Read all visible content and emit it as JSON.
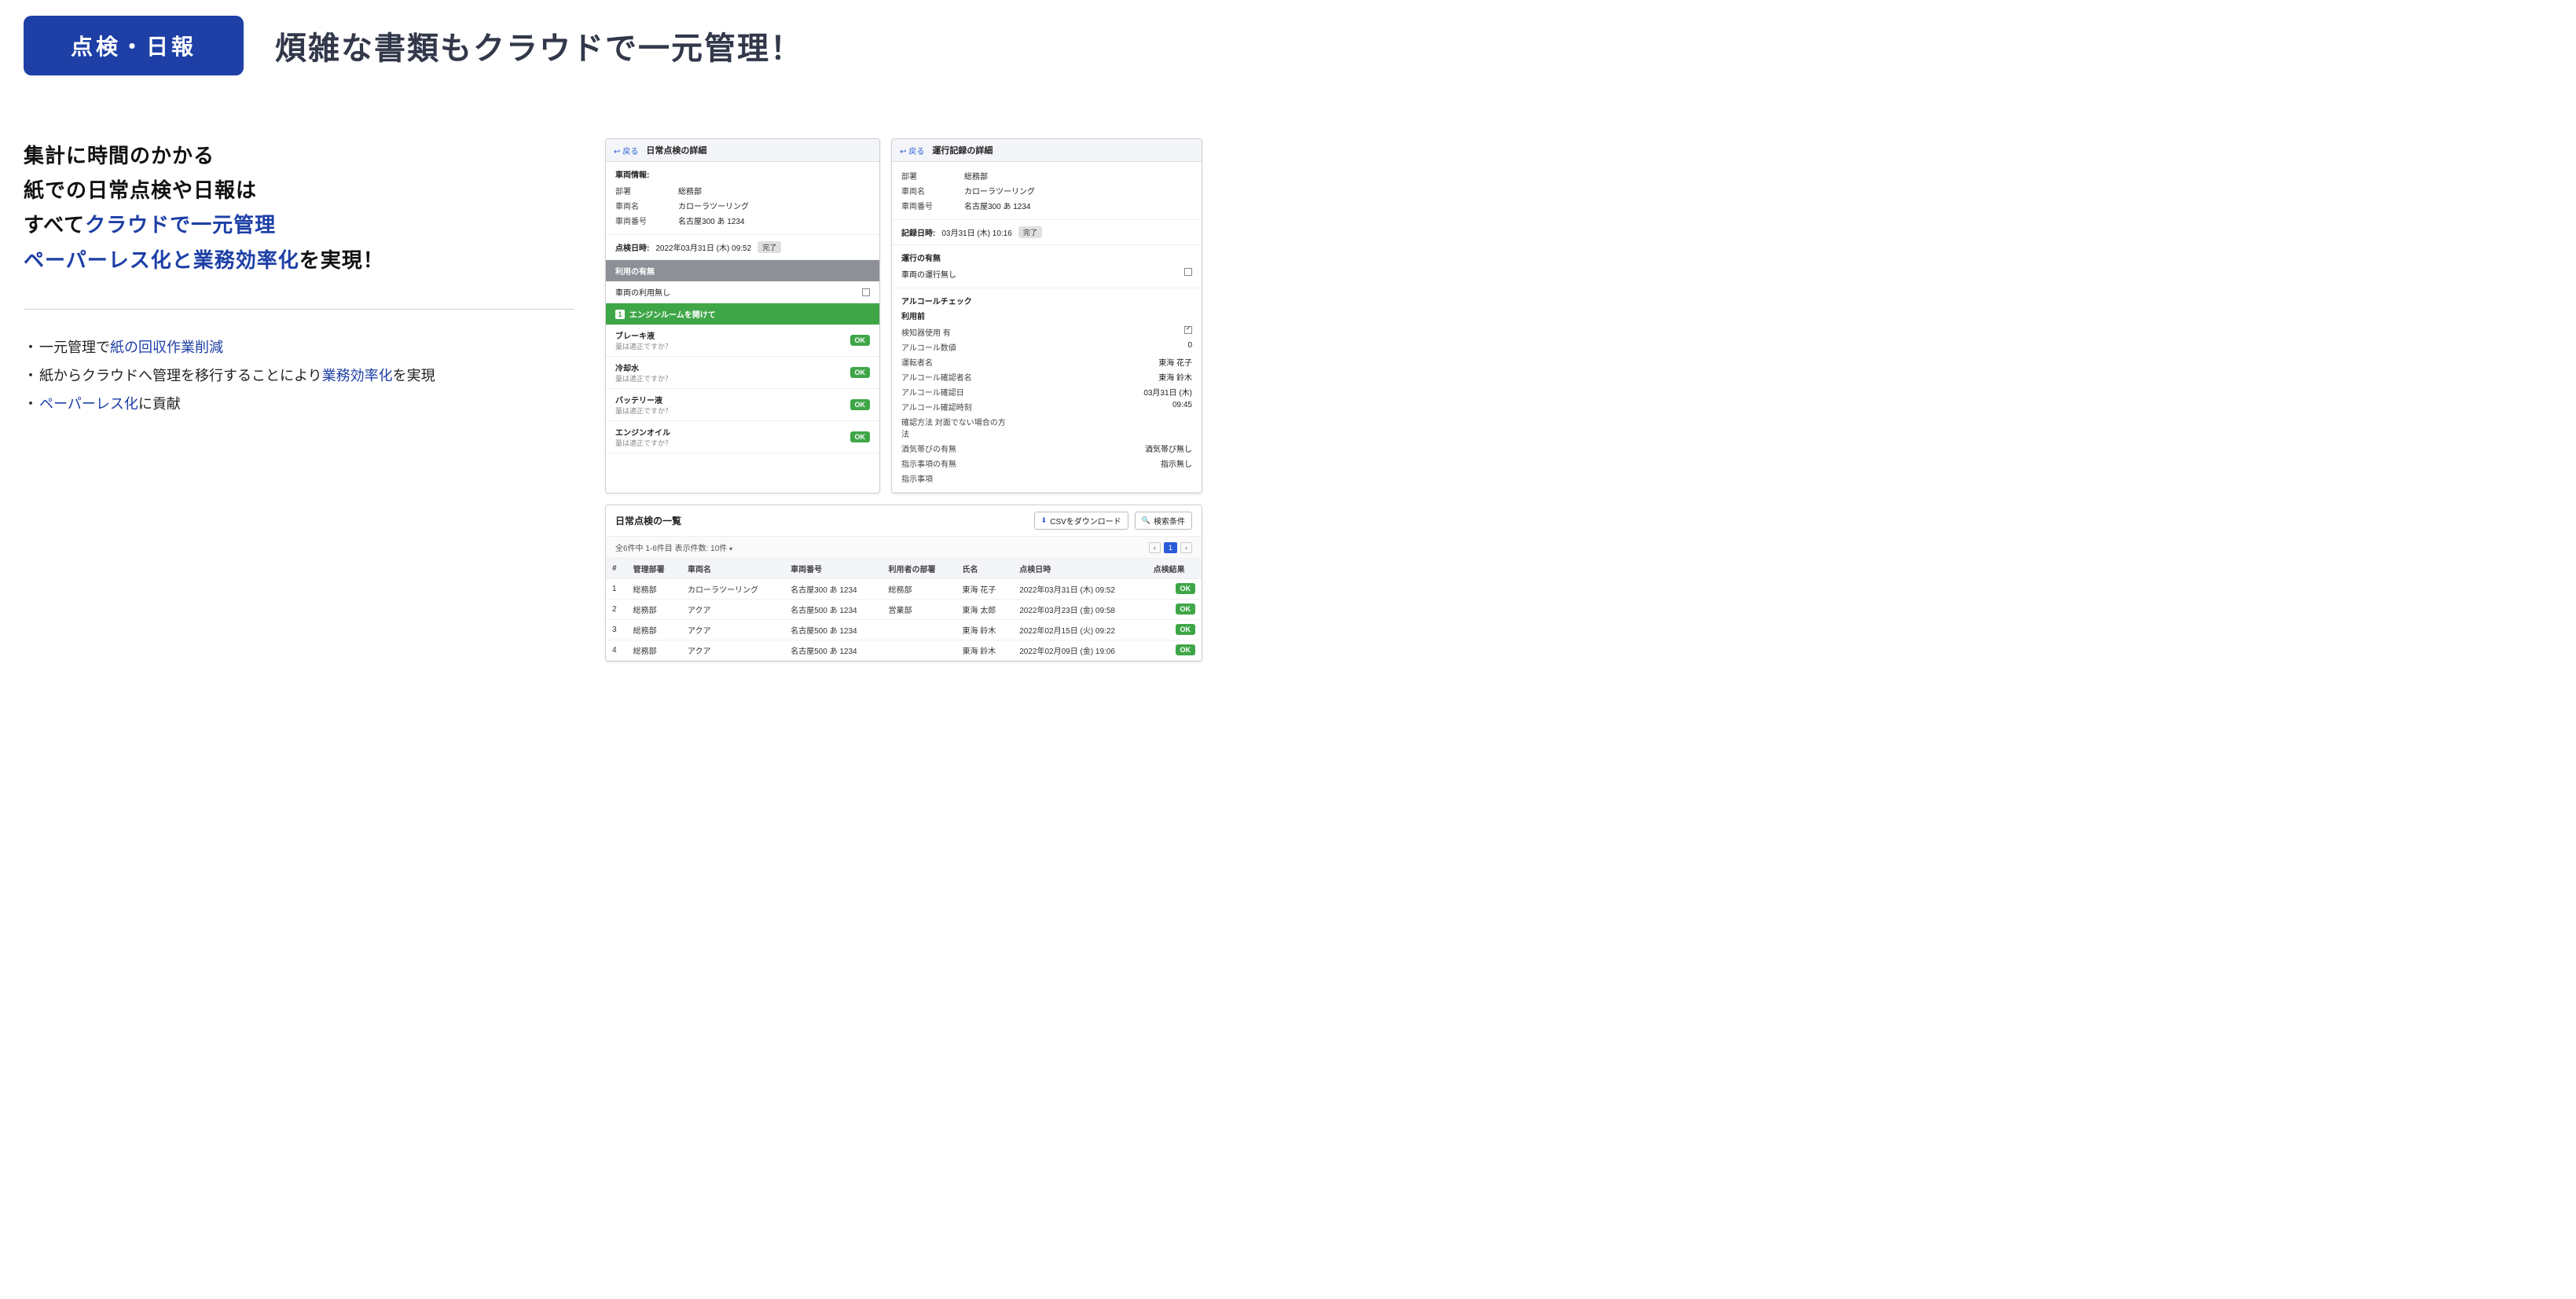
{
  "top": {
    "badge": "点検・日報",
    "headline": "煩雑な書類もクラウドで一元管理！"
  },
  "left": {
    "line1": "集計に時間のかかる",
    "line2": "紙での日常点検や日報は",
    "line3a": "すべて",
    "line3b": "クラウドで一元管理",
    "line4a": "ペーパーレス化と業務効率化",
    "line4b": "を実現！",
    "b1a": "一元管理で",
    "b1b": "紙の回収作業削減",
    "b2a": "紙からクラウドへ管理を移行することにより",
    "b2b": "業務効率化",
    "b2c": "を実現",
    "b3a": "ペーパーレス化",
    "b3b": "に貢献"
  },
  "panel1": {
    "back": "戻る",
    "title": "日常点検の詳細",
    "info_title": "車両情報:",
    "dept_k": "部署",
    "dept_v": "総務部",
    "name_k": "車両名",
    "name_v": "カローラツーリング",
    "num_k": "車両番号",
    "num_v": "名古屋300 あ 1234",
    "dt_k": "点検日時:",
    "dt_v": "2022年03月31日 (木) 09:52",
    "dt_status": "完了",
    "sec1": "利用の有無",
    "sec1_val": "車両の利用無し",
    "sec2_num": "1",
    "sec2": "エンジンルームを開けて",
    "items": [
      {
        "label": "ブレーキ液",
        "sub": "量は適正ですか？"
      },
      {
        "label": "冷却水",
        "sub": "量は適正ですか？"
      },
      {
        "label": "バッテリー液",
        "sub": "量は適正ですか？"
      },
      {
        "label": "エンジンオイル",
        "sub": "量は適正ですか？"
      }
    ],
    "ok": "OK"
  },
  "panel2": {
    "back": "戻る",
    "title": "運行記録の詳細",
    "dept_k": "部署",
    "dept_v": "総務部",
    "name_k": "車両名",
    "name_v": "カローラツーリング",
    "num_k": "車両番号",
    "num_v": "名古屋300 あ 1234",
    "rec_k": "記録日時:",
    "rec_v": "03月31日 (木) 10:16",
    "rec_status": "完了",
    "op_title": "運行の有無",
    "op_val": "車両の運行無し",
    "alc_title": "アルコールチェック",
    "alc_sub": "利用前",
    "rows": [
      {
        "k": "検知器使用 有",
        "v": "☑",
        "cb": true
      },
      {
        "k": "アルコール数値",
        "v": "0"
      },
      {
        "k": "運転者名",
        "v": "東海 花子"
      },
      {
        "k": "アルコール確認者名",
        "v": "東海 鈴木"
      },
      {
        "k": "アルコール確認日",
        "v": "03月31日 (木)"
      },
      {
        "k": "アルコール確認時刻",
        "v": "09:45"
      },
      {
        "k": "確認方法 対面でない場合の方法",
        "v": ""
      },
      {
        "k": "酒気帯びの有無",
        "v": "酒気帯び無し"
      },
      {
        "k": "指示事項の有無",
        "v": "指示無し"
      },
      {
        "k": "指示事項",
        "v": ""
      }
    ]
  },
  "list": {
    "title": "日常点検の一覧",
    "csv": "CSVをダウンロード",
    "search": "検索条件",
    "summary": "全6件中 1-6件目 表示件数: 10件",
    "page": "1",
    "headers": [
      "#",
      "管理部署",
      "車両名",
      "車両番号",
      "利用者の部署",
      "氏名",
      "点検日時",
      "点検結果"
    ],
    "rows": [
      [
        "1",
        "総務部",
        "カローラツーリング",
        "名古屋300 あ 1234",
        "総務部",
        "東海 花子",
        "2022年03月31日 (木) 09:52"
      ],
      [
        "2",
        "総務部",
        "アクア",
        "名古屋500 あ 1234",
        "営業部",
        "東海 太郎",
        "2022年03月23日 (金) 09:58"
      ],
      [
        "3",
        "総務部",
        "アクア",
        "名古屋500 あ 1234",
        "",
        "東海 鈴木",
        "2022年02月15日 (火) 09:22"
      ],
      [
        "4",
        "総務部",
        "アクア",
        "名古屋500 あ 1234",
        "",
        "東海 鈴木",
        "2022年02月09日 (金) 19:06"
      ]
    ],
    "ok": "OK"
  }
}
